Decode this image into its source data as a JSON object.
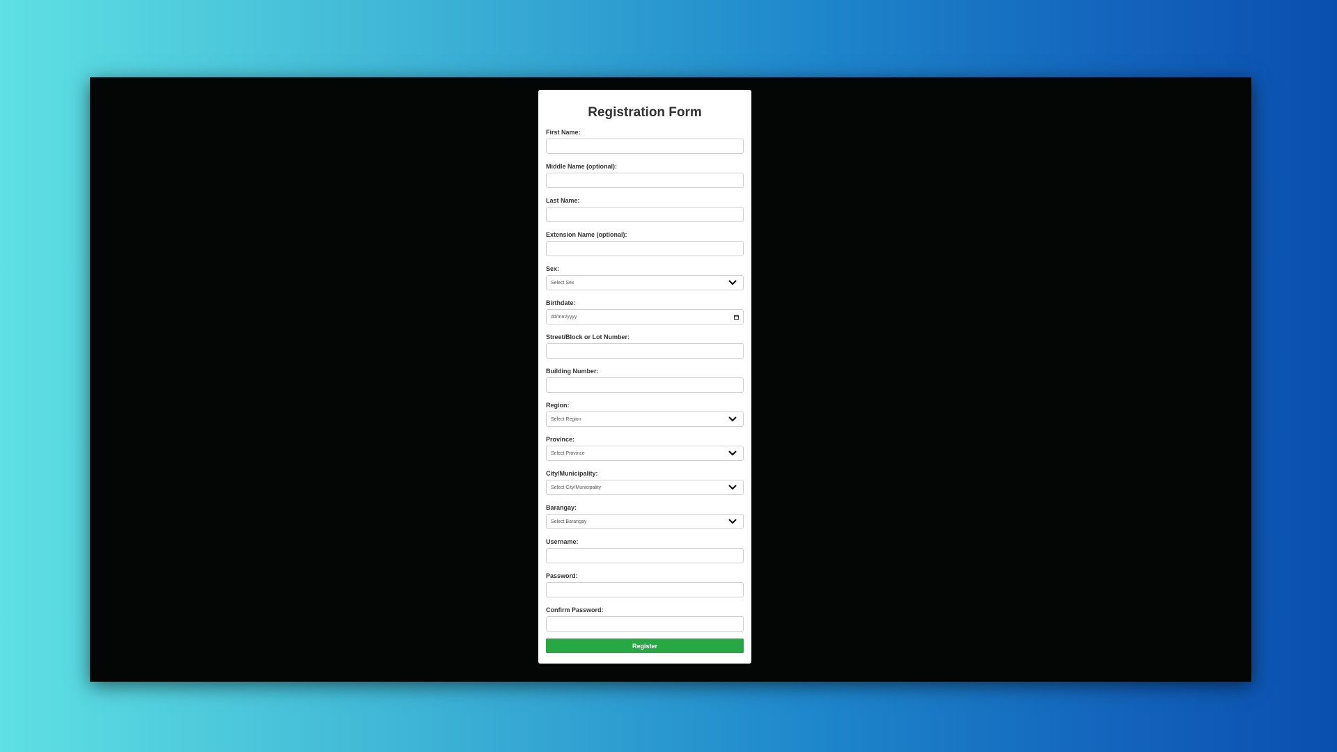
{
  "form": {
    "title": "Registration Form",
    "fields": {
      "first_name": {
        "label": "First Name:",
        "value": ""
      },
      "middle_name": {
        "label": "Middle Name (optional):",
        "value": ""
      },
      "last_name": {
        "label": "Last Name:",
        "value": ""
      },
      "extension_name": {
        "label": "Extension Name (optional):",
        "value": ""
      },
      "sex": {
        "label": "Sex:",
        "selected": "Select Sex"
      },
      "birthdate": {
        "label": "Birthdate:",
        "placeholder": "dd/mm/yyyy"
      },
      "street": {
        "label": "Street/Block or Lot Number:",
        "value": ""
      },
      "building": {
        "label": "Building Number:",
        "value": ""
      },
      "region": {
        "label": "Region:",
        "selected": "Select Region"
      },
      "province": {
        "label": "Province:",
        "selected": "Select Province"
      },
      "city": {
        "label": "City/Municipality:",
        "selected": "Select City/Municipality"
      },
      "barangay": {
        "label": "Barangay:",
        "selected": "Select Barangay"
      },
      "username": {
        "label": "Username:",
        "value": ""
      },
      "password": {
        "label": "Password:",
        "value": ""
      },
      "confirm_password": {
        "label": "Confirm Password:",
        "value": ""
      }
    },
    "submit_label": "Register"
  },
  "icons": {
    "dropdown": "chevron-down-icon",
    "calendar": "calendar-icon"
  },
  "colors": {
    "register_button": "#28a745",
    "window_bg": "#040605",
    "card_bg": "#ffffff"
  }
}
